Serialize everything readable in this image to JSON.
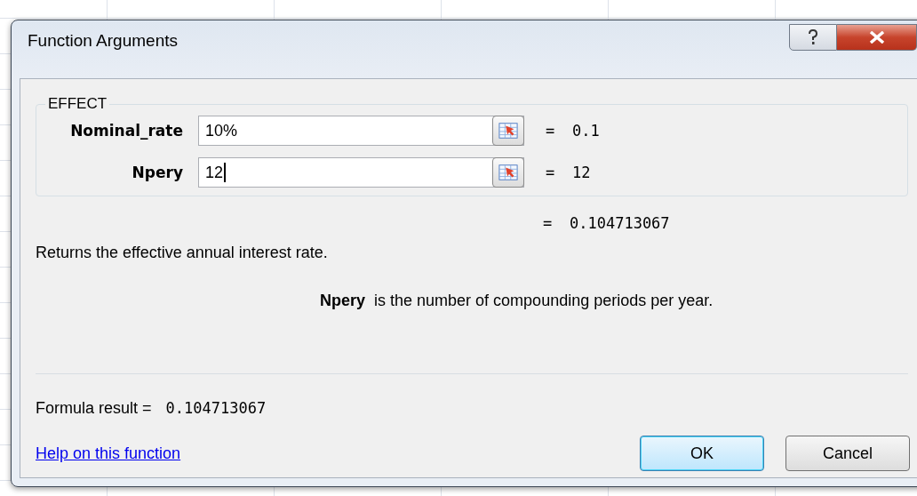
{
  "window": {
    "title": "Function Arguments"
  },
  "function_group": {
    "name": "EFFECT",
    "arguments": [
      {
        "label": "Nominal_rate",
        "value": "10%",
        "equals": "=",
        "evaluated": "0.1",
        "focused": false
      },
      {
        "label": "Npery",
        "value": "12",
        "equals": "=",
        "evaluated": "12",
        "focused": true
      }
    ]
  },
  "result_preview": {
    "equals": "=",
    "value": "0.104713067"
  },
  "description": "Returns the effective annual interest rate.",
  "argument_help": "**Npery**  is the number of compounding periods per year.",
  "formula_result": {
    "label": "Formula result =",
    "value": "0.104713067"
  },
  "help_link": "Help on this function",
  "buttons": [
    {
      "label": "OK",
      "default": true
    },
    {
      "label": "Cancel",
      "default": false
    }
  ]
}
